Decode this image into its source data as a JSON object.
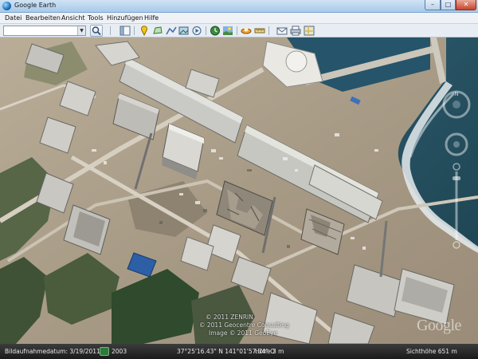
{
  "window": {
    "title": "Google Earth",
    "controls": [
      "minimize",
      "maximize",
      "close"
    ]
  },
  "menu": [
    {
      "label": "Datei",
      "accel": "D"
    },
    {
      "label": "Bearbeiten",
      "accel": "B"
    },
    {
      "label": "Ansicht",
      "accel": "A"
    },
    {
      "label": "Tools",
      "accel": "T"
    },
    {
      "label": "Hinzufügen",
      "accel": "H"
    },
    {
      "label": "Hilfe",
      "accel": "H"
    }
  ],
  "toolbar": {
    "search_value": "",
    "icons": [
      "sidebar-toggle-icon",
      "placemark-icon",
      "polygon-icon",
      "path-icon",
      "image-overlay-icon",
      "tour-icon",
      "historical-imagery-icon",
      "sunlight-icon",
      "planets-icon",
      "ruler-icon",
      "email-icon",
      "print-icon",
      "maps-icon"
    ]
  },
  "map": {
    "watermark": "Google",
    "copyright_lines": [
      "© 2011 ZENRIN",
      "© 2011 Geocentre Consulting",
      "Image © 2011 GeoEye"
    ]
  },
  "statusbar": {
    "imagery_date": "Bildaufnahmedatum: 3/19/2011",
    "year": "2003",
    "coordinates": "37°25'16.43\" N  141°01'57.34\" O",
    "elevation": "Höhe   3 m",
    "eye_altitude": "Sichthöhe     651 m"
  },
  "colors": {
    "accent": "#1b6fb8",
    "ocean": "#2b5a6b",
    "statusbar": "#1b1b1b"
  }
}
